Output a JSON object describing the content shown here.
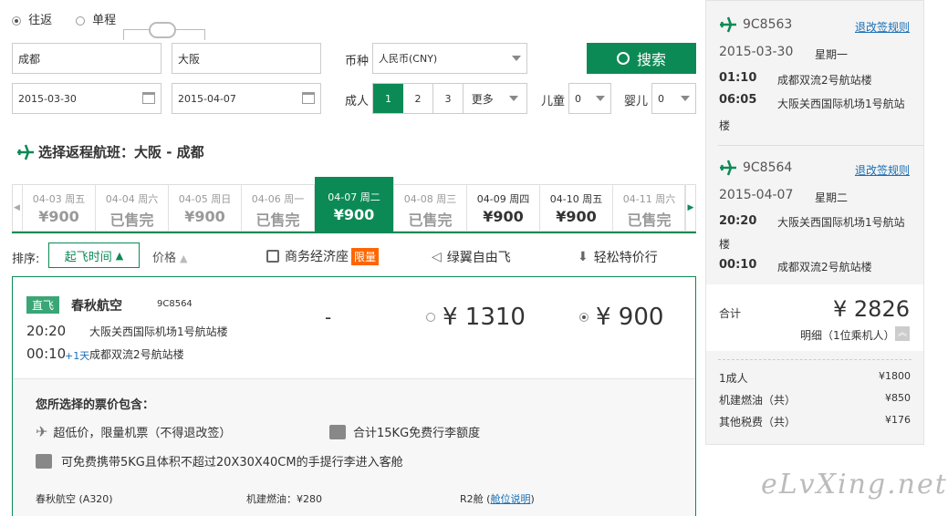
{
  "trip": {
    "roundtrip": "往返",
    "oneway": "单程"
  },
  "search": {
    "from": "成都",
    "to": "大阪",
    "depart_date": "2015-03-30",
    "return_date": "2015-04-07",
    "currency_label": "币种",
    "currency_value": "人民币(CNY)",
    "search_button": "搜索",
    "adult_label": "成人",
    "adult_options": [
      "1",
      "2",
      "3"
    ],
    "more_label": "更多",
    "child_label": "儿童",
    "child_value": "0",
    "infant_label": "婴儿",
    "infant_value": "0"
  },
  "section_title": "选择返程航班：大阪 - 成都",
  "date_tabs": [
    {
      "date": "04-03",
      "day": "周五",
      "price": "¥900",
      "state": "past"
    },
    {
      "date": "04-04",
      "day": "周六",
      "price": "已售完",
      "state": "past"
    },
    {
      "date": "04-05",
      "day": "周日",
      "price": "¥900",
      "state": "past"
    },
    {
      "date": "04-06",
      "day": "周一",
      "price": "已售完",
      "state": "past"
    },
    {
      "date": "04-07",
      "day": "周二",
      "price": "¥900",
      "state": "selected"
    },
    {
      "date": "04-08",
      "day": "周三",
      "price": "已售完",
      "state": "past"
    },
    {
      "date": "04-09",
      "day": "周四",
      "price": "¥900",
      "state": "dark"
    },
    {
      "date": "04-10",
      "day": "周五",
      "price": "¥900",
      "state": "dark"
    },
    {
      "date": "04-11",
      "day": "周六",
      "price": "已售完",
      "state": "past"
    }
  ],
  "sort": {
    "label": "排序:",
    "depart_time": "起飞时间",
    "price": "价格",
    "business": "商务经济座",
    "limited": "限量",
    "green": "绿翼自由飞",
    "budget": "轻松特价行"
  },
  "flight": {
    "badge": "直飞",
    "airline": "春秋航空",
    "number": "9C8564",
    "dep_time": "20:20",
    "dep_airport": "大阪关西国际机场1号航站楼",
    "arr_time": "00:10",
    "arr_plus": "+1天",
    "arr_airport": "成都双流2号航站楼",
    "dash": "-",
    "price1": "¥ 1310",
    "price2": "¥ 900"
  },
  "details": {
    "title": "您所选择的票价包含：",
    "item1": "超低价，限量机票（不得退改签）",
    "item2": "合计15KG免费行李额度",
    "item3": "可免费携带5KG且体积不超过20X30X40CM的手提行李进入客舱",
    "aircraft": "春秋航空 (A320)",
    "fuel": "机建燃油：¥280",
    "cabin": "R2舱",
    "cabin_link": "舱位说明"
  },
  "summary": {
    "out": {
      "number": "9C8563",
      "change_link": "退改签规则",
      "date": "2015-03-30",
      "weekday": "星期一",
      "dep_time": "01:10",
      "dep_airport": "成都双流2号航站楼",
      "arr_time": "06:05",
      "arr_airport": "大阪关西国际机场1号航站楼"
    },
    "ret": {
      "number": "9C8564",
      "change_link": "退改签规则",
      "date": "2015-04-07",
      "weekday": "星期二",
      "dep_time": "20:20",
      "dep_airport": "大阪关西国际机场1号航站楼",
      "arr_time": "00:10",
      "arr_airport": "成都双流2号航站楼"
    },
    "total_label": "合计",
    "total_value": "¥ 2826",
    "detail_label": "明细（1位乘机人）",
    "rows": [
      {
        "label": "1成人",
        "value": "¥1800"
      },
      {
        "label": "机建燃油（共）",
        "value": "¥850"
      },
      {
        "label": "其他税费（共）",
        "value": "¥176"
      }
    ]
  },
  "watermark": "eLvXing.net",
  "colors": {
    "accent": "#0c8a55",
    "orange": "#f60",
    "link": "#1a6fb4"
  }
}
